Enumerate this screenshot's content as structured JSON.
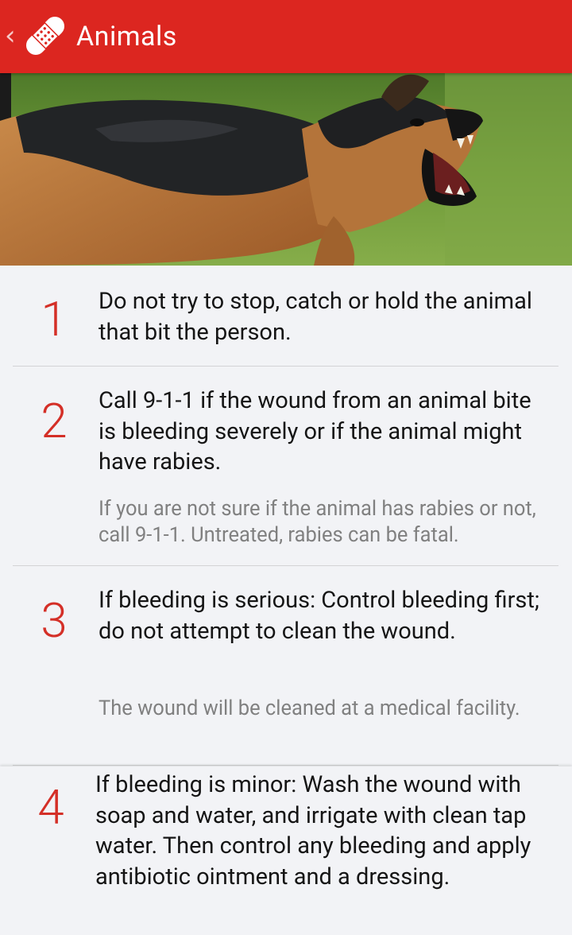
{
  "appbar": {
    "title": "Animals",
    "back_icon": "chevron-left-icon",
    "logo_icon": "bandage-icon",
    "color": "#dc2620"
  },
  "hero": {
    "subject": "aggressive dog photo"
  },
  "steps": [
    {
      "number": "1",
      "text": "Do not try to stop, catch or hold the animal that bit the person."
    },
    {
      "number": "2",
      "text": "Call 9-1-1 if the wound from an animal bite is bleeding severely or if the animal might have rabies.",
      "note": "If you are not sure if the animal has rabies or not, call 9-1-1. Untreated, rabies can be fatal."
    },
    {
      "number": "3",
      "text": "If bleeding is serious: Control bleeding first; do not attempt to clean the wound.",
      "note": "The wound will be cleaned at a medical facility."
    },
    {
      "number": "4",
      "text": "If bleeding is minor: Wash the wound with soap and water, and irrigate with clean tap water. Then control any bleeding and apply antibiotic ointment and a dressing."
    }
  ],
  "colors": {
    "accent": "#dc2620",
    "number": "#d42f27",
    "background": "#f2f3f6",
    "note_text": "#808080"
  }
}
